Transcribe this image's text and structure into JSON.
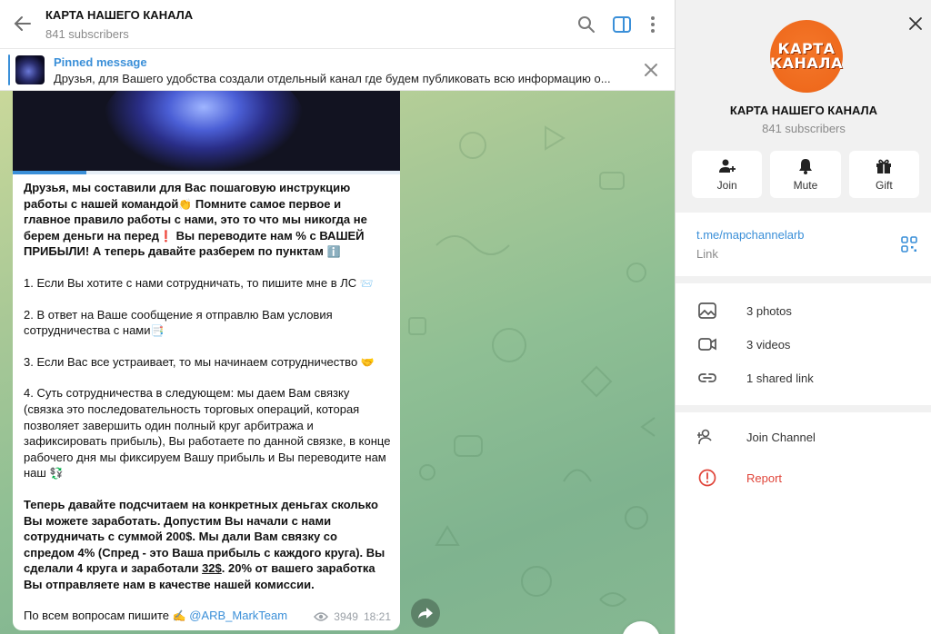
{
  "header": {
    "title": "КАРТА НАШЕГО КАНАЛА",
    "subscribers": "841 subscribers"
  },
  "pinned": {
    "label": "Pinned message",
    "text": "Друзья, для Вашего удобства создали отдельный канал где будем публиковать всю информацию о..."
  },
  "post": {
    "progress": 0.19,
    "p1": "Друзья, мы составили для Вас пошаговую инструкцию работы с нашей командой",
    "p1b": " Помните самое первое и главное правило работы с нами, это то что мы никогда не берем деньги на перед",
    "p1c": " Вы переводите нам % с ВАШЕЙ ПРИБЫЛИ! А теперь давайте разберем по пунктам",
    "item1": "1. Если Вы хотите с нами сотрудничать, то пишите мне в ЛС",
    "item2": "2. В ответ на Ваше сообщение я отправлю Вам условия сотрудничества с нами",
    "item3": "3. Если Вас все устраивает, то мы начинаем сотрудничество",
    "item4": "4. Суть сотрудничества в следующем: мы даем Вам связку (связка это последовательность торговых операций, которая позволяет завершить один полный круг арбитража и зафиксировать прибыль), Вы работаете по данной связке, в конце рабочего дня мы фиксируем Вашу прибыль и Вы переводите нам наш",
    "bold_a": "Теперь давайте подсчитаем на конкретных деньгах сколько Вы можете заработать. Допустим Вы начали с нами сотрудничать с суммой 200$. Мы дали Вам связку со спредом 4% (Спред - это Ваша прибыль с каждого круга). Вы сделали 4 круга и заработали ",
    "bold_u": "32$",
    "bold_b": ". 20% от вашего заработка Вы отправляете нам в качестве нашей комиссии.",
    "contact_prefix": "По всем вопросам пишите",
    "contact_handle": "@ARB_MarkTeam",
    "views": "3949",
    "time": "18:21"
  },
  "panel": {
    "avatar_line1": "КАРТА",
    "avatar_line2": "КАНАЛА",
    "name": "КАРТА НАШЕГО КАНАЛА",
    "subscribers": "841 subscribers",
    "join_label": "Join",
    "mute_label": "Mute",
    "gift_label": "Gift",
    "link_url": "t.me/mapchannelarb",
    "link_label": "Link",
    "photos": "3 photos",
    "videos": "3 videos",
    "shared_links": "1 shared link",
    "join_channel": "Join Channel",
    "report": "Report"
  },
  "colors": {
    "accent": "#3a8fd8",
    "danger": "#e0453a",
    "avatar": "#ef6a1d"
  }
}
